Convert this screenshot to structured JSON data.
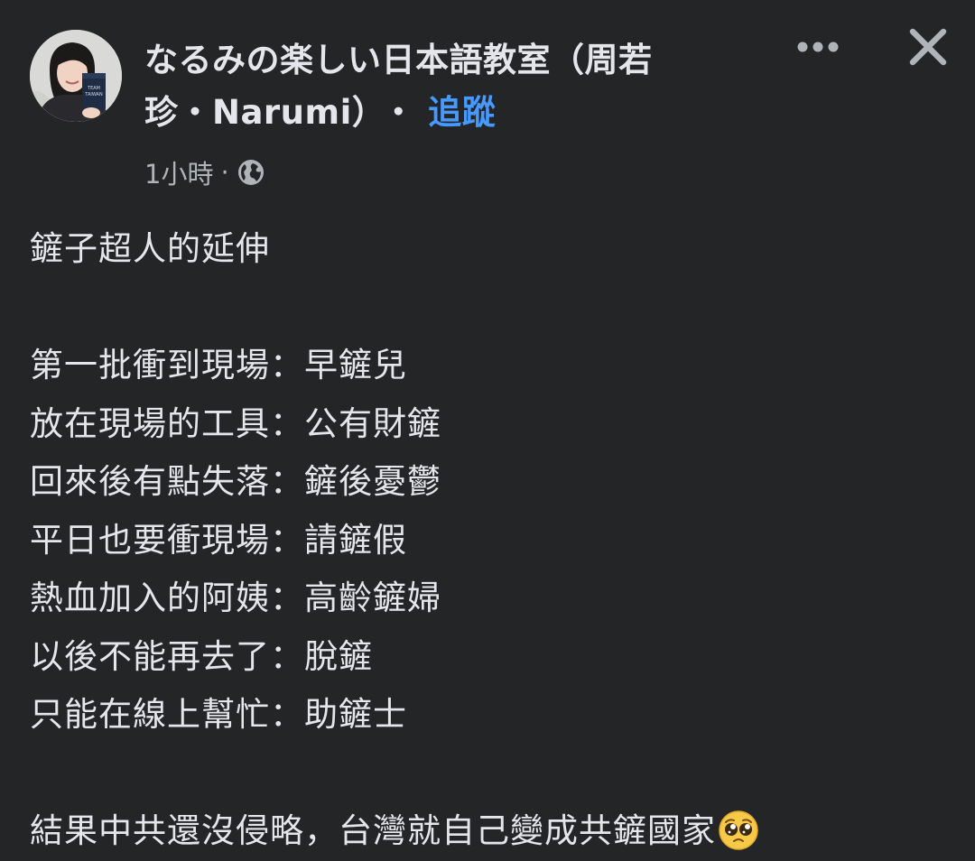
{
  "author": {
    "name_line1": "なるみの楽しい日本語教室（周若",
    "name_line2": "珍・Narumi）",
    "separator": "・",
    "follow_label": "追蹤"
  },
  "meta": {
    "timestamp": "1小時",
    "dot": "·",
    "audience_icon": "globe-icon"
  },
  "actions": {
    "more_icon": "more-options-icon",
    "close_icon": "close-icon"
  },
  "post": {
    "title": "鏟子超人的延伸",
    "lines": [
      "第一批衝到現場：早鏟兒",
      "放在現場的工具：公有財鏟",
      "回來後有點失落：鏟後憂鬱",
      "平日也要衝現場：請鏟假",
      "熱血加入的阿姨：高齡鏟婦",
      "以後不能再去了：脫鏟",
      "只能在線上幫忙：助鏟士"
    ],
    "closing": "結果中共還沒侵略，台灣就自己變成共鏟國家",
    "closing_emoji": "pleading-face-emoji"
  },
  "colors": {
    "background": "#242526",
    "text": "#e4e6eb",
    "secondary_text": "#b0b3b8",
    "link": "#4599ff"
  }
}
